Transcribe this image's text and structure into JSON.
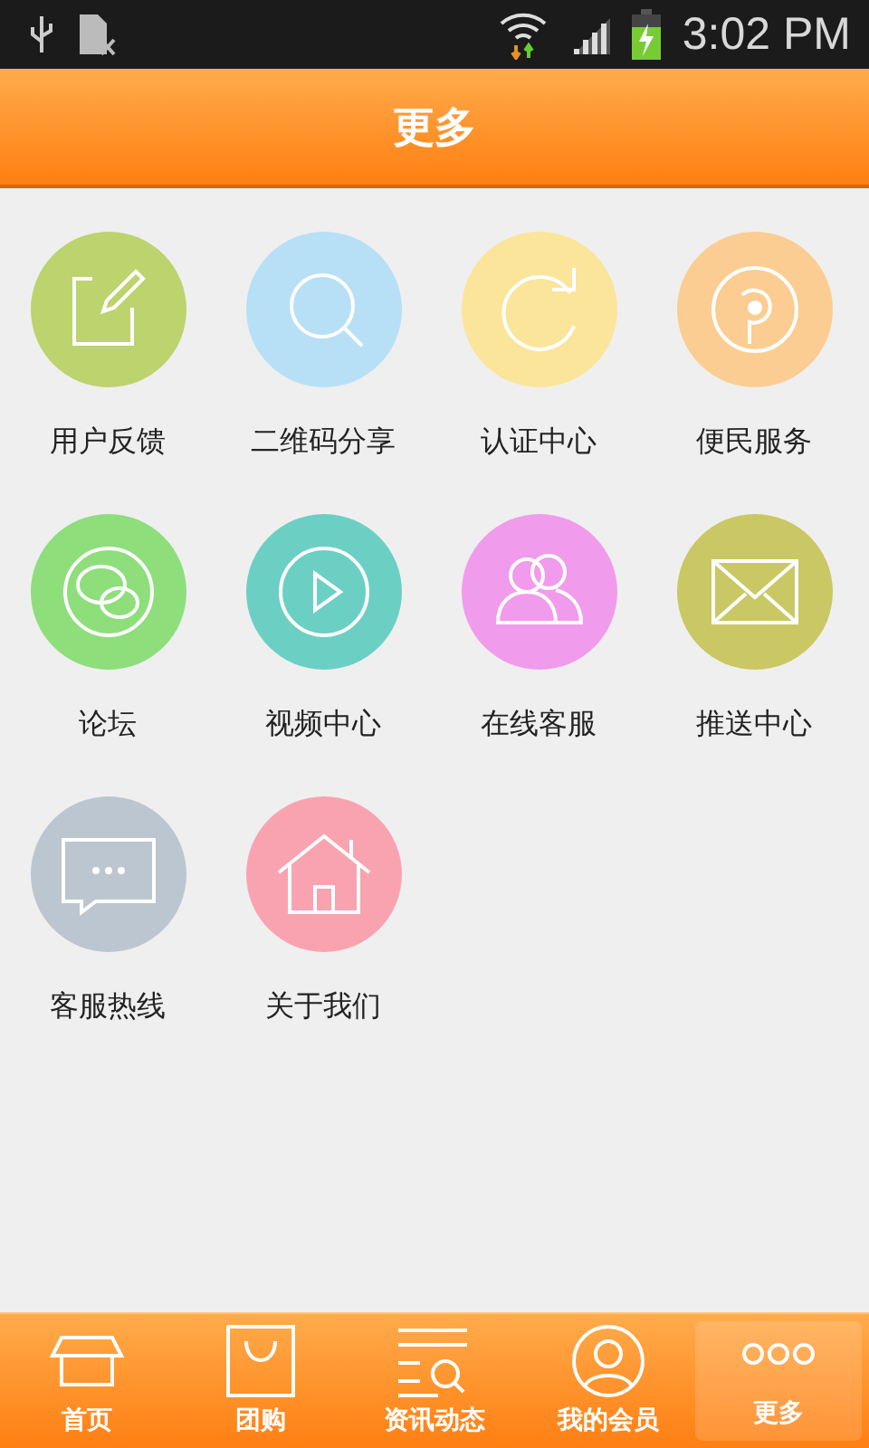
{
  "status_bar": {
    "time": "3:02 PM"
  },
  "header": {
    "title": "更多"
  },
  "items": [
    {
      "label": "用户反馈",
      "color": "#bcd36e"
    },
    {
      "label": "二维码分享",
      "color": "#b7e0f7"
    },
    {
      "label": "认证中心",
      "color": "#fbe59a"
    },
    {
      "label": "便民服务",
      "color": "#fbcd92"
    },
    {
      "label": "论坛",
      "color": "#8ede7c"
    },
    {
      "label": "视频中心",
      "color": "#6ccfc4"
    },
    {
      "label": "在线客服",
      "color": "#f19bec"
    },
    {
      "label": "推送中心",
      "color": "#c9c864"
    },
    {
      "label": "客服热线",
      "color": "#bcc6d0"
    },
    {
      "label": "关于我们",
      "color": "#f9a3b1"
    }
  ],
  "tabs": [
    {
      "label": "首页",
      "selected": false
    },
    {
      "label": "团购",
      "selected": false
    },
    {
      "label": "资讯动态",
      "selected": false
    },
    {
      "label": "我的会员",
      "selected": false
    },
    {
      "label": "更多",
      "selected": true
    }
  ]
}
